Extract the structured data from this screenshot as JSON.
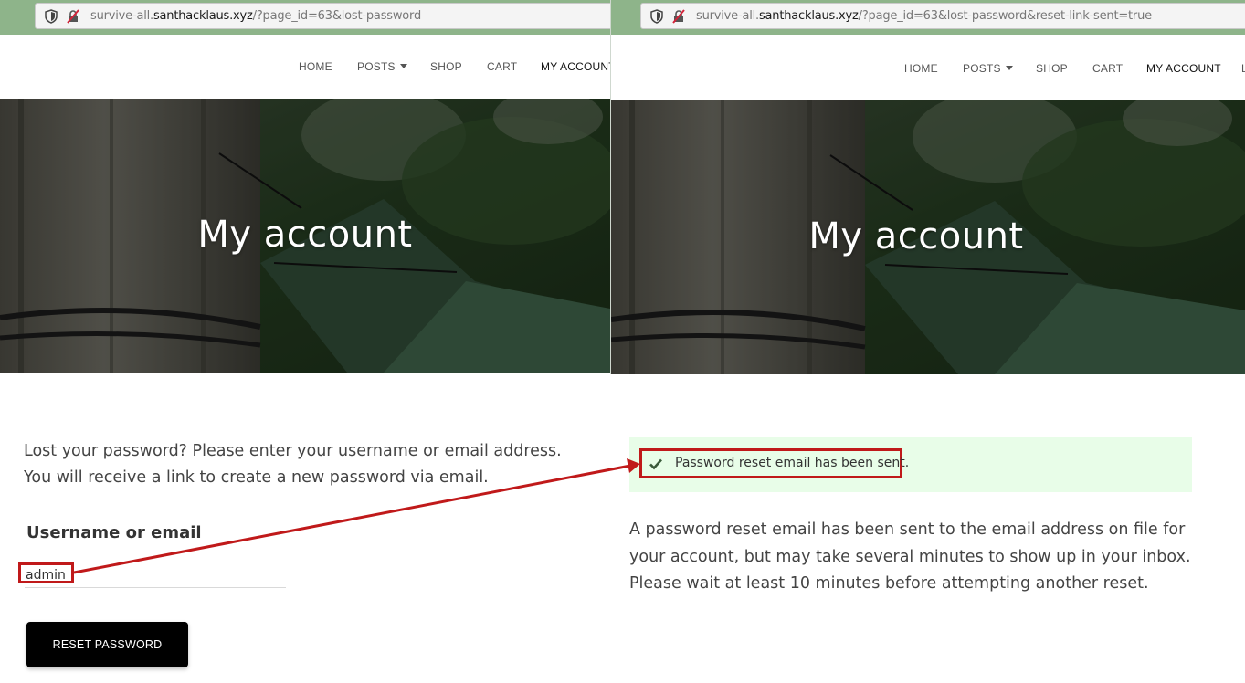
{
  "left": {
    "url": {
      "prefix": "survive-all.",
      "host": "santhacklaus.xyz",
      "path": "/?page_id=63&lost-password"
    },
    "nav": [
      {
        "label": "HOME"
      },
      {
        "label": "POSTS",
        "dropdown": true
      },
      {
        "label": "SHOP"
      },
      {
        "label": "CART"
      },
      {
        "label": "MY ACCOUNT",
        "active": true
      }
    ],
    "hero_title": "My account",
    "intro": "Lost your password? Please enter your username or email address. You will receive a link to create a new password via email.",
    "field_label": "Username or email",
    "field_value": "admin",
    "button_label": "RESET PASSWORD"
  },
  "right": {
    "url": {
      "prefix": "survive-all.",
      "host": "santhacklaus.xyz",
      "path": "/?page_id=63&lost-password&reset-link-sent=true"
    },
    "nav": [
      {
        "label": "HOME"
      },
      {
        "label": "POSTS",
        "dropdown": true
      },
      {
        "label": "SHOP"
      },
      {
        "label": "CART"
      },
      {
        "label": "MY ACCOUNT",
        "active": true
      },
      {
        "label": "L"
      }
    ],
    "hero_title": "My account",
    "notice": "Password reset email has been sent.",
    "message": "A password reset email has been sent to the email address on file for your account, but may take several minutes to show up in your inbox. Please wait at least 10 minutes before attempting another reset."
  },
  "colors": {
    "browser_chrome": "#8eb48a",
    "highlight": "#c0191a",
    "notice_bg": "#e8fde8",
    "button_bg": "#000000"
  },
  "icons": [
    "shield-icon",
    "tracking-blocked-icon",
    "caret-down-icon",
    "check-icon"
  ]
}
